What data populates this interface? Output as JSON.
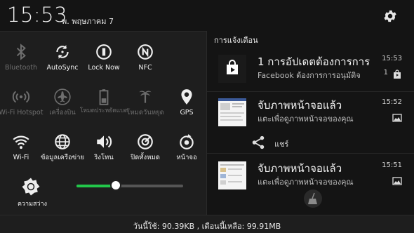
{
  "status": {
    "time": "15:53",
    "date": "พ. พฤษภาคม 7"
  },
  "quick_settings": {
    "tiles": [
      {
        "label": "Bluetooth",
        "icon": "bluetooth-icon",
        "enabled": false
      },
      {
        "label": "AutoSync",
        "icon": "sync-icon",
        "enabled": true
      },
      {
        "label": "Lock Now",
        "icon": "lock-now-icon",
        "enabled": true
      },
      {
        "label": "NFC",
        "icon": "nfc-icon",
        "enabled": true
      },
      {
        "label": "Wi-Fi Hotspot",
        "icon": "hotspot-icon",
        "enabled": false
      },
      {
        "label": "เครื่องบิน",
        "icon": "airplane-icon",
        "enabled": false
      },
      {
        "label": "โหมดประหยัดแบต",
        "icon": "battery-saver-icon",
        "enabled": false
      },
      {
        "label": "โหมดวันหยุด",
        "icon": "holiday-icon",
        "enabled": false
      },
      {
        "label": "GPS",
        "icon": "gps-icon",
        "enabled": true
      },
      {
        "label": "Wi-Fi",
        "icon": "wifi-icon",
        "enabled": true
      },
      {
        "label": "ข้อมูลเครือข่าย",
        "icon": "mobile-data-icon",
        "enabled": true
      },
      {
        "label": "ริงโทน",
        "icon": "ringtone-icon",
        "enabled": true
      },
      {
        "label": "ปิดทั้งหมด",
        "icon": "close-all-icon",
        "enabled": true
      },
      {
        "label": "หน้าจอ",
        "icon": "screen-rotate-icon",
        "enabled": true
      }
    ],
    "brightness": {
      "label": "ความสว่าง",
      "level": 0.37
    }
  },
  "notifications": {
    "title": "การแจ้งเตือน",
    "items": [
      {
        "title": "1 การอัปเดตต้องการการ",
        "text": "Facebook ต้องการการอนุมัติจ",
        "time": "15:53",
        "count": "1",
        "icon": "play-store-icon"
      },
      {
        "title": "จับภาพหน้าจอแล้ว",
        "text": "แตะเพื่อดูภาพหน้าจอของคุณ",
        "time": "15:52",
        "icon": "screenshot-icon"
      },
      {
        "title": "จับภาพหน้าจอแล้ว",
        "text": "แตะเพื่อดูภาพหน้าจอของคุณ",
        "time": "15:51",
        "icon": "screenshot-icon"
      }
    ],
    "share_label": "แชร์"
  },
  "footer": {
    "usage": "วันนี้ใช้: 90.39KB , เดือนนี้เหลือ: 99.91MB"
  },
  "colors": {
    "accent": "#22c74a",
    "background": "#141414",
    "panel": "#1e1e1e"
  }
}
